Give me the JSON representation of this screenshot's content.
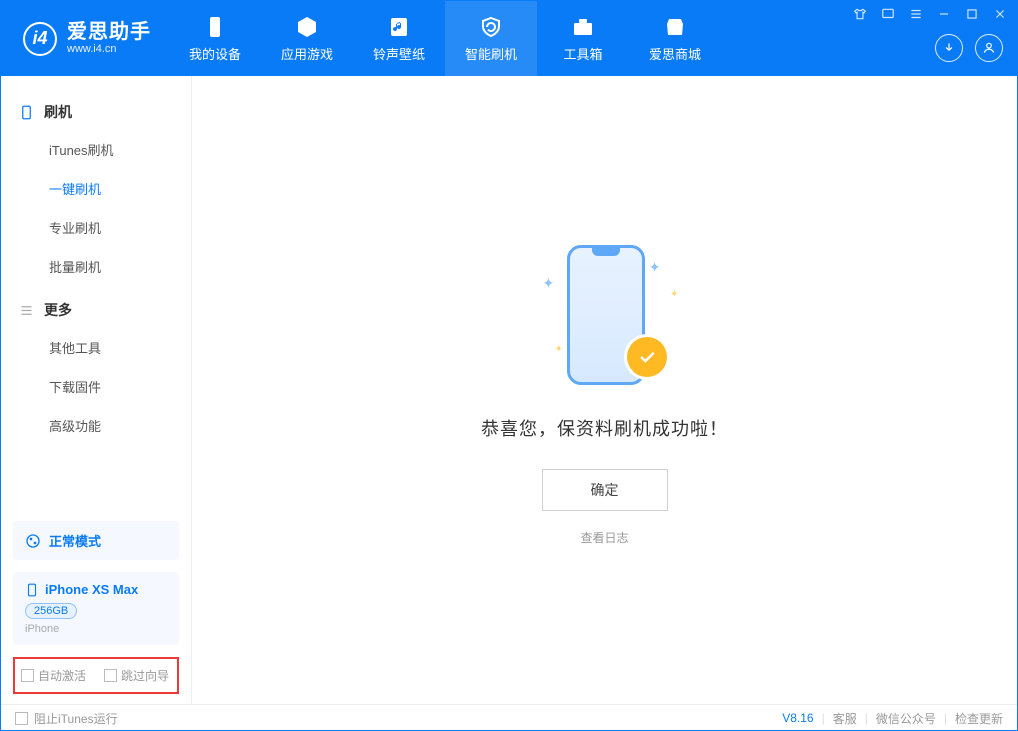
{
  "app": {
    "title": "爱思助手",
    "subtitle": "www.i4.cn"
  },
  "nav": [
    {
      "label": "我的设备"
    },
    {
      "label": "应用游戏"
    },
    {
      "label": "铃声壁纸"
    },
    {
      "label": "智能刷机"
    },
    {
      "label": "工具箱"
    },
    {
      "label": "爱思商城"
    }
  ],
  "sidebar": {
    "group1": {
      "title": "刷机",
      "items": [
        "iTunes刷机",
        "一键刷机",
        "专业刷机",
        "批量刷机"
      ]
    },
    "group2": {
      "title": "更多",
      "items": [
        "其他工具",
        "下载固件",
        "高级功能"
      ]
    },
    "mode": "正常模式",
    "device": {
      "name": "iPhone XS Max",
      "capacity": "256GB",
      "type": "iPhone"
    },
    "opts": {
      "auto_activate": "自动激活",
      "skip_guide": "跳过向导"
    }
  },
  "main": {
    "success_text": "恭喜您，保资料刷机成功啦！",
    "ok": "确定",
    "view_log": "查看日志"
  },
  "footer": {
    "block_itunes": "阻止iTunes运行",
    "version": "V8.16",
    "support": "客服",
    "wechat": "微信公众号",
    "update": "检查更新"
  }
}
